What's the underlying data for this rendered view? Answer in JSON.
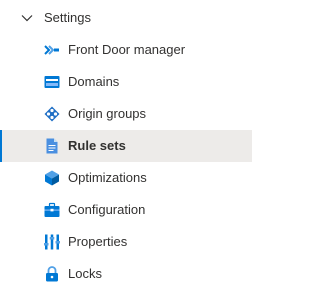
{
  "nav": {
    "group": {
      "label": "Settings",
      "expanded": true,
      "chevron_icon": "chevron-down-icon"
    },
    "items": [
      {
        "label": "Front Door manager",
        "icon": "front-door-icon",
        "selected": false
      },
      {
        "label": "Domains",
        "icon": "domains-icon",
        "selected": false
      },
      {
        "label": "Origin groups",
        "icon": "origin-groups-icon",
        "selected": false
      },
      {
        "label": "Rule sets",
        "icon": "rule-sets-icon",
        "selected": true
      },
      {
        "label": "Optimizations",
        "icon": "optimizations-icon",
        "selected": false
      },
      {
        "label": "Configuration",
        "icon": "configuration-icon",
        "selected": false
      },
      {
        "label": "Properties",
        "icon": "properties-icon",
        "selected": false
      },
      {
        "label": "Locks",
        "icon": "lock-icon",
        "selected": false
      }
    ],
    "colors": {
      "selection_background": "#edebe9",
      "selection_indicator": "#0078d4",
      "text": "#323130"
    }
  }
}
